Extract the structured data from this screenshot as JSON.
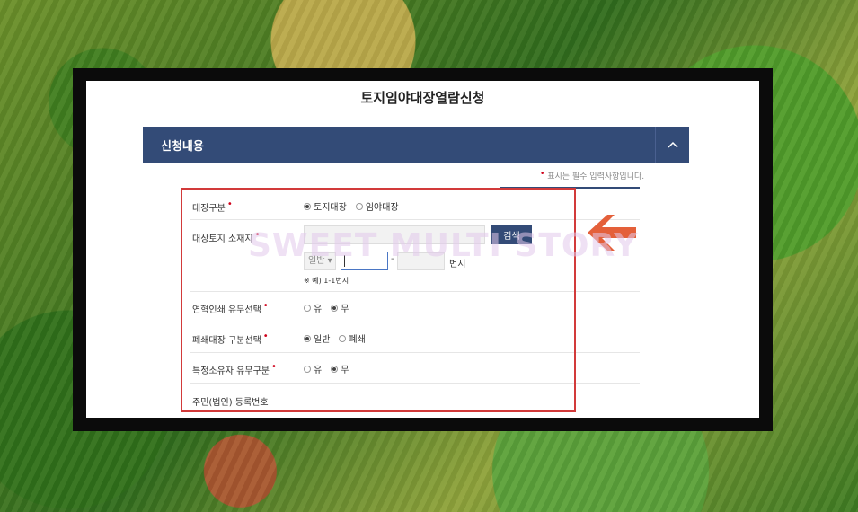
{
  "page": {
    "title": "토지임야대장열람신청"
  },
  "section": {
    "title": "신청내용"
  },
  "required_note": "표시는 필수 입력사항입니다.",
  "rows": {
    "ledger_type": {
      "label": "대장구분",
      "options": [
        {
          "label": "토지대장",
          "selected": true
        },
        {
          "label": "임야대장",
          "selected": false
        }
      ]
    },
    "address": {
      "label": "대상토지 소재지",
      "search_label": "검색",
      "general_select": "일반",
      "beonji_label": "번지",
      "dash": "-",
      "example": "※ 예) 1-1번지"
    },
    "history": {
      "label": "연혁인쇄 유무선택",
      "options": [
        {
          "label": "유",
          "selected": false
        },
        {
          "label": "무",
          "selected": true
        }
      ]
    },
    "closed_ledger": {
      "label": "폐쇄대장 구분선택",
      "options": [
        {
          "label": "일반",
          "selected": true
        },
        {
          "label": "폐쇄",
          "selected": false
        }
      ]
    },
    "owner": {
      "label": "특정소유자 유무구분",
      "options": [
        {
          "label": "유",
          "selected": false
        },
        {
          "label": "무",
          "selected": true
        }
      ]
    },
    "resident_number": {
      "label": "주민(법인) 등록번호"
    }
  },
  "watermark": "SWEET MULTI STORY",
  "colors": {
    "header": "#334b77",
    "highlight_box": "#d23a3a",
    "arrow": "#e4603a",
    "required_dot": "#d0021b"
  },
  "icons": {
    "collapse": "chevron-up-icon",
    "pointer": "left-arrow-icon"
  }
}
